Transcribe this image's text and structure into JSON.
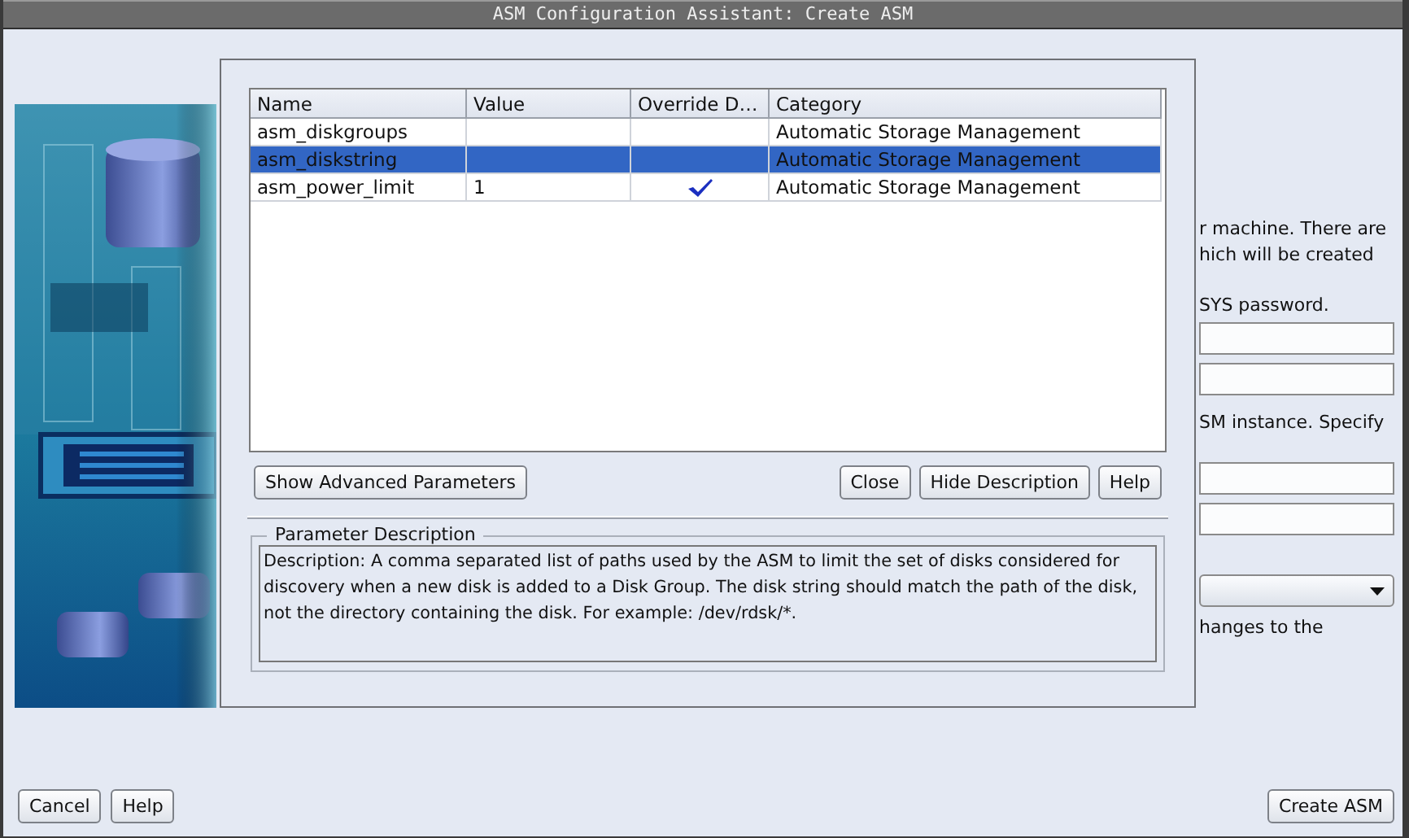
{
  "window": {
    "title": "ASM Configuration Assistant: Create ASM"
  },
  "background_form": {
    "items": [
      {
        "kind": "text",
        "text": "r machine. There are"
      },
      {
        "kind": "text",
        "text": "hich will be created"
      },
      {
        "kind": "text",
        "text": "SYS password."
      },
      {
        "kind": "field"
      },
      {
        "kind": "field"
      },
      {
        "kind": "text",
        "text": "SM instance. Specify"
      },
      {
        "kind": "field"
      },
      {
        "kind": "field"
      },
      {
        "kind": "dropdown"
      },
      {
        "kind": "text",
        "text": "hanges to the"
      }
    ]
  },
  "parameters_dialog": {
    "table": {
      "columns": [
        "Name",
        "Value",
        "Override D…",
        "Category"
      ],
      "rows": [
        {
          "name": "asm_diskgroups",
          "value": "",
          "override": false,
          "category": "Automatic Storage Management",
          "selected": false
        },
        {
          "name": "asm_diskstring",
          "value": "",
          "override": false,
          "category": "Automatic Storage Management",
          "selected": true
        },
        {
          "name": "asm_power_limit",
          "value": "1",
          "override": true,
          "category": "Automatic Storage Management",
          "selected": false
        }
      ]
    },
    "left_buttons": [
      "Show Advanced Parameters"
    ],
    "right_buttons": [
      "Close",
      "Hide Description",
      "Help"
    ],
    "description": {
      "title": "Parameter Description",
      "text": "Description: A comma separated list of paths used by the ASM to limit the set of disks considered for discovery when a new disk is added to a Disk Group. The disk string should match the path of the disk, not the directory containing the disk. For example: /dev/rdsk/*."
    }
  },
  "footer": {
    "left_buttons": [
      "Cancel",
      "Help"
    ],
    "right_buttons": [
      "Create ASM"
    ]
  }
}
